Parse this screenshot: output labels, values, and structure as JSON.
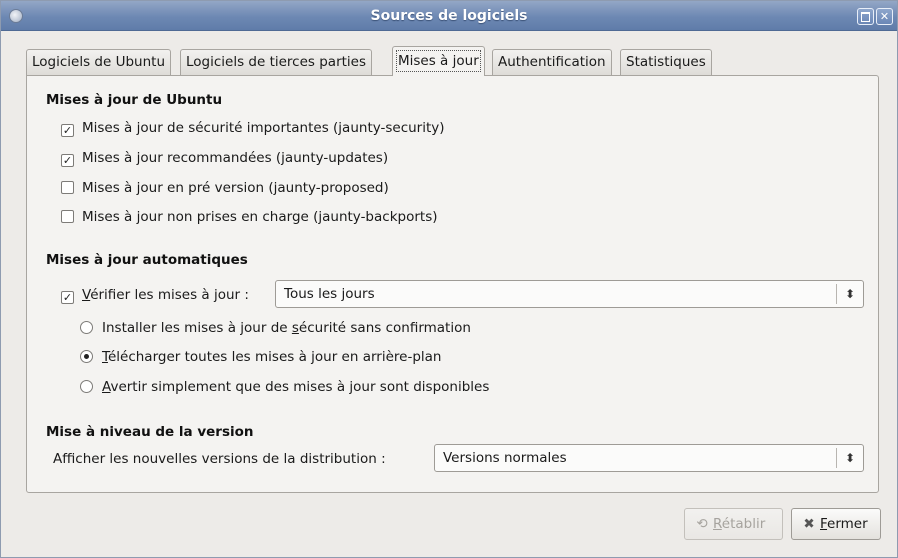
{
  "window": {
    "title": "Sources de logiciels"
  },
  "tabs": [
    {
      "label": "Logiciels de Ubuntu"
    },
    {
      "label": "Logiciels de tierces parties"
    },
    {
      "label": "Mises à jour"
    },
    {
      "label": "Authentification"
    },
    {
      "label": "Statistiques"
    }
  ],
  "ubuntu_updates": {
    "title": "Mises à jour de Ubuntu",
    "items": [
      {
        "label": "Mises à jour de sécurité importantes (jaunty-security)",
        "checked": true
      },
      {
        "label": "Mises à jour recommandées (jaunty-updates)",
        "checked": true
      },
      {
        "label": "Mises à jour en pré version (jaunty-proposed)",
        "checked": false
      },
      {
        "label": "Mises à jour non prises en charge (jaunty-backports)",
        "checked": false
      }
    ]
  },
  "auto_updates": {
    "title": "Mises à jour automatiques",
    "check_mnemonic": "V",
    "check_label_rest": "érifier les mises à jour :",
    "checked": true,
    "frequency": "Tous les jours",
    "options": [
      {
        "before": "Installer les mises à jour de ",
        "mnemonic": "s",
        "after": "écurité sans confirmation",
        "selected": false
      },
      {
        "before": "",
        "mnemonic": "T",
        "after": "élécharger toutes les mises à jour en arrière-plan",
        "selected": true
      },
      {
        "before": "",
        "mnemonic": "A",
        "after": "vertir simplement que des mises à jour sont disponibles",
        "selected": false
      }
    ]
  },
  "release_upgrade": {
    "title": "Mise à niveau de la version",
    "label": "Afficher les nouvelles versions de la distribution :",
    "value": "Versions normales"
  },
  "buttons": {
    "revert_mnemonic": "R",
    "revert_rest": "établir",
    "close_mnemonic": "F",
    "close_rest": "ermer"
  },
  "glyphs": {
    "check": "✓",
    "combo_arrow": "⬍",
    "close_x": "✕",
    "revert_icon": "⟲",
    "close_icon": "✖"
  }
}
